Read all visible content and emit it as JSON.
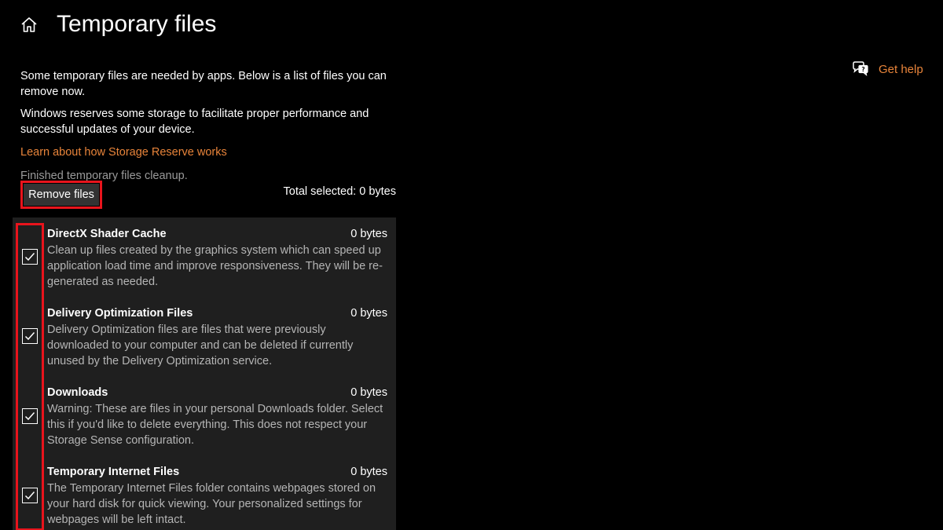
{
  "header": {
    "title": "Temporary files",
    "home_icon": "home-icon"
  },
  "help": {
    "label": "Get help",
    "icon": "get-help-icon"
  },
  "intro": {
    "line1": "Some temporary files are needed by apps. Below is a list of files you can remove now.",
    "line2": "Windows reserves some storage to facilitate proper performance and successful updates of your device."
  },
  "learn_link": "Learn about how Storage Reserve works",
  "status": "Finished temporary files cleanup.",
  "remove_button": "Remove files",
  "total_selected": "Total selected: 0 bytes",
  "items": [
    {
      "name": "DirectX Shader Cache",
      "size": "0 bytes",
      "checked": true,
      "description": "Clean up files created by the graphics system which can speed up application load time and improve responsiveness. They will be re-generated as needed."
    },
    {
      "name": "Delivery Optimization Files",
      "size": "0 bytes",
      "checked": true,
      "description": "Delivery Optimization files are files that were previously downloaded to your computer and can be deleted if currently unused by the Delivery Optimization service."
    },
    {
      "name": "Downloads",
      "size": "0 bytes",
      "checked": true,
      "description": "Warning: These are files in your personal Downloads folder. Select this if you'd like to delete everything. This does not respect your Storage Sense configuration."
    },
    {
      "name": "Temporary Internet Files",
      "size": "0 bytes",
      "checked": true,
      "description": "The Temporary Internet Files folder contains webpages stored on your hard disk for quick viewing. Your personalized settings for webpages will be left intact."
    }
  ],
  "colors": {
    "background": "#000000",
    "accent_link": "#e8843a",
    "highlight_border": "#e8141c",
    "panel": "#1f1f1f",
    "button": "#333333"
  }
}
